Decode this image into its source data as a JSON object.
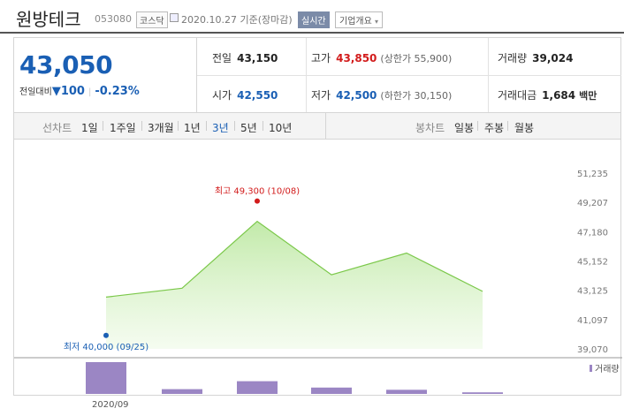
{
  "header": {
    "name": "원방테크",
    "code": "053080",
    "market": "코스닥",
    "date": "2020.10.27 기준(장마감)",
    "realtime_label": "실시간",
    "company_info_label": "기업개요"
  },
  "quote": {
    "price": "43,050",
    "compare_label": "전일대비",
    "change": "100",
    "change_pct": "-0.23%",
    "prev_close": {
      "label": "전일",
      "value": "43,150"
    },
    "high": {
      "label": "고가",
      "value": "43,850",
      "sub": "(상한가 55,900)"
    },
    "volume": {
      "label": "거래량",
      "value": "39,024"
    },
    "open": {
      "label": "시가",
      "value": "42,550"
    },
    "low": {
      "label": "저가",
      "value": "42,500",
      "sub": "(하한가 30,150)"
    },
    "amount": {
      "label": "거래대금",
      "value": "1,684",
      "unit": "백만"
    }
  },
  "periods": {
    "title": "선차트",
    "items": [
      "1일",
      "1주일",
      "3개월",
      "1년",
      "3년",
      "5년",
      "10년"
    ],
    "active": "3년"
  },
  "candle_periods": {
    "title": "봉차트",
    "items": [
      "일봉",
      "주봉",
      "월봉"
    ]
  },
  "colors": {
    "accent_blue": "#1a5fb4",
    "up_red": "#d21b1b",
    "line_green": "#7bc84a",
    "volume_purple": "#9b86c4"
  },
  "chart_data": {
    "type": "area",
    "x": [
      "09/25",
      "",
      "10/08",
      "",
      "",
      ""
    ],
    "values": [
      42650,
      43270,
      47900,
      44200,
      45700,
      43050
    ],
    "ylim": [
      39070,
      51235
    ],
    "yticks": [
      "51,235",
      "49,207",
      "47,180",
      "45,152",
      "43,125",
      "41,097",
      "39,070"
    ],
    "max_annotation": "최고 49,300 (10/08)",
    "min_annotation": "최저 40,000 (09/25)",
    "max_value": 49300,
    "min_value": 40000,
    "volume": [
      10.0,
      1.5,
      4.0,
      2.0,
      1.3,
      0.5
    ],
    "volume_label": "거래량",
    "xlabel_tick": "2020/09"
  }
}
